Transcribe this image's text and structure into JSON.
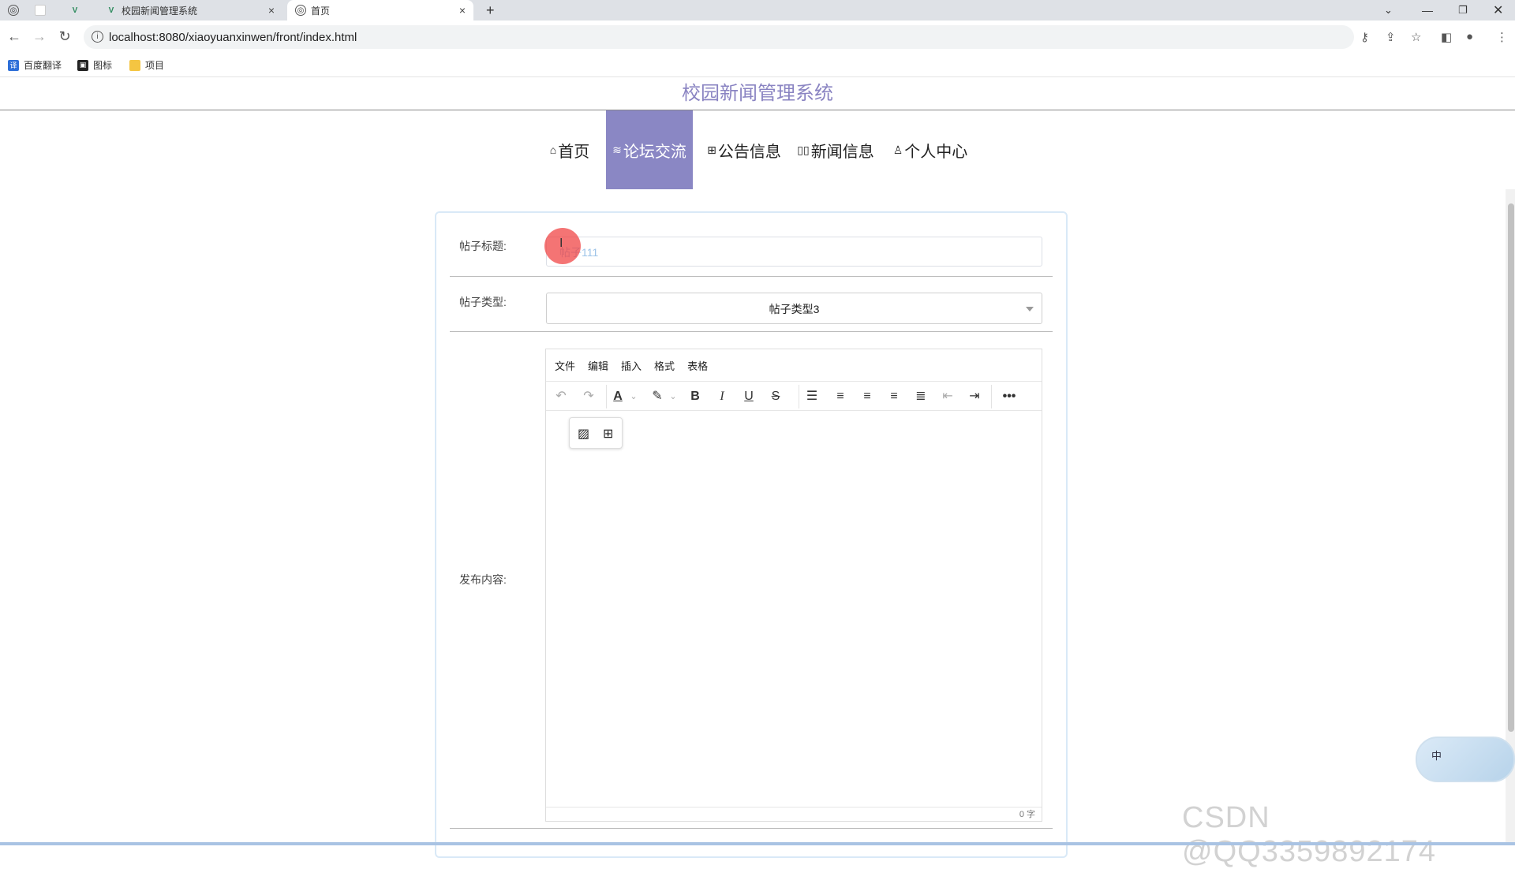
{
  "browser": {
    "tabs": [
      {
        "label": "",
        "icon": "globe-icon"
      },
      {
        "label": "",
        "icon": "blank-icon"
      },
      {
        "label": "",
        "icon": "vue-icon"
      },
      {
        "label": "校园新闻管理系统",
        "icon": "vue-icon"
      },
      {
        "label": "首页",
        "icon": "globe-icon"
      }
    ],
    "new_tab": "+",
    "url": "localhost:8080/xiaoyuanxinwen/front/index.html",
    "bookmarks": [
      {
        "label": "百度翻译",
        "icon": "translate-icon"
      },
      {
        "label": "图标",
        "icon": "image-icon"
      },
      {
        "label": "项目",
        "icon": "folder-icon"
      }
    ]
  },
  "site": {
    "title": "校园新闻管理系统",
    "nav": [
      {
        "label": "首页",
        "icon": "home-icon"
      },
      {
        "label": "论坛交流",
        "icon": "layers-icon",
        "active": true
      },
      {
        "label": "公告信息",
        "icon": "grid-icon"
      },
      {
        "label": "新闻信息",
        "icon": "book-icon"
      },
      {
        "label": "个人中心",
        "icon": "user-icon"
      }
    ]
  },
  "form": {
    "title_label": "帖子标题:",
    "title_value": "帖子111",
    "type_label": "帖子类型:",
    "type_value": "帖子类型3",
    "content_label": "发布内容:",
    "editor_menu": [
      "文件",
      "编辑",
      "插入",
      "格式",
      "表格"
    ],
    "word_count": "0 字"
  },
  "overlay": {
    "widget_text": "中",
    "watermark": "CSDN @QQ3359892174"
  },
  "colors": {
    "accent": "#8a87c4",
    "title": "#8a84c2"
  }
}
